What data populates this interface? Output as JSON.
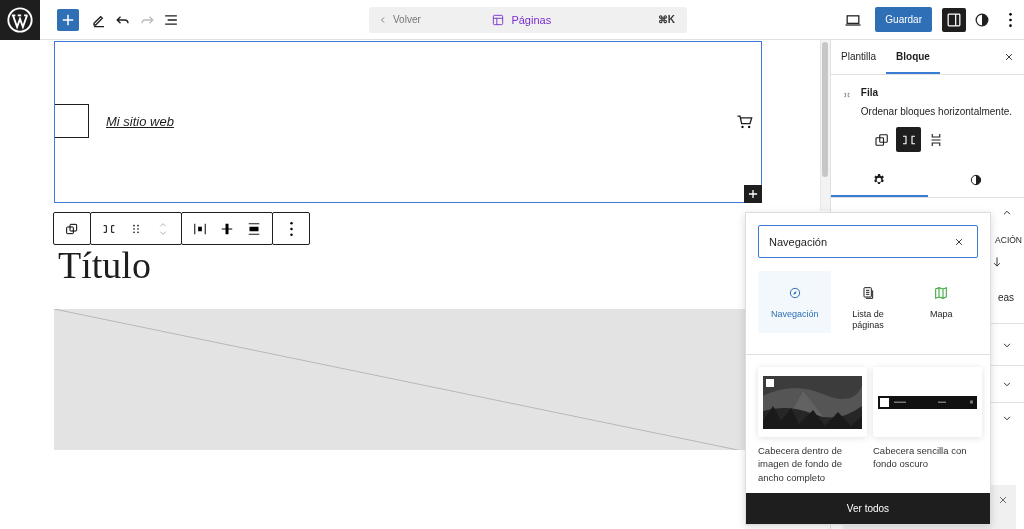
{
  "top_bar": {
    "back": "Volver",
    "title": "Páginas",
    "shortcut": "⌘K",
    "save": "Guardar"
  },
  "canvas": {
    "site_title": "Mi sitio web",
    "heading": "Título"
  },
  "sidebar": {
    "tabs": [
      {
        "label": "Plantilla",
        "selected": false
      },
      {
        "label": "Bloque",
        "selected": true
      }
    ],
    "block": {
      "name": "Fila",
      "description": "Ordenar bloques horizontalmente."
    },
    "variations": [
      {
        "kind": "group",
        "selected": false
      },
      {
        "kind": "row",
        "selected": true
      },
      {
        "kind": "stack",
        "selected": false
      }
    ],
    "panel_tabs": [
      {
        "kind": "settings",
        "selected": true
      },
      {
        "kind": "styles",
        "selected": false
      }
    ],
    "fragments": [
      "ACIÓN",
      "eas"
    ]
  },
  "popover": {
    "search": {
      "value": "Navegación"
    },
    "results": [
      {
        "kind": "navigation",
        "label": "Navegación",
        "selected": true
      },
      {
        "kind": "pages",
        "label": "Lista de páginas",
        "selected": false
      },
      {
        "kind": "map",
        "label": "Mapa",
        "selected": false
      }
    ],
    "patterns": [
      {
        "label": "Cabecera dentro de imagen de fondo de ancho completo"
      },
      {
        "kind": "dark",
        "label": "Cabecera sencilla con fondo oscuro"
      }
    ],
    "footer": "Ver todos"
  }
}
